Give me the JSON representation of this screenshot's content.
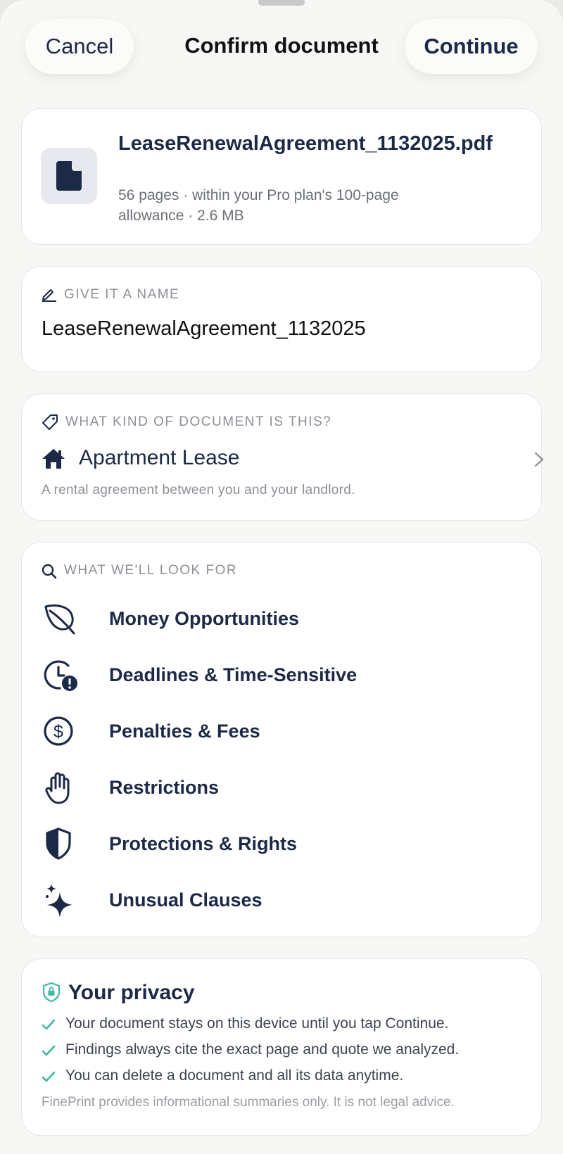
{
  "nav": {
    "cancel_label": "Cancel",
    "title": "Confirm document",
    "continue_label": "Continue"
  },
  "file": {
    "name": "LeaseRenewalAgreement_1132025.pdf",
    "meta": "56 pages · within your Pro plan's 100-page allowance · 2.6 MB",
    "icon": "document-icon"
  },
  "name_section": {
    "label": "GIVE IT A NAME",
    "icon": "pencil-icon",
    "value": "LeaseRenewalAgreement_1132025"
  },
  "doc_type": {
    "label": "WHAT KIND OF DOCUMENT IS THIS?",
    "icon": "tag-icon",
    "selected": "Apartment Lease",
    "selected_icon": "house-icon",
    "description": "A rental agreement between you and your landlord."
  },
  "look_for": {
    "label": "WHAT WE'LL LOOK FOR",
    "icon": "search-icon",
    "items": [
      {
        "label": "Money Opportunities",
        "icon": "leaf-icon"
      },
      {
        "label": "Deadlines & Time-Sensitive",
        "icon": "clock-alert-icon"
      },
      {
        "label": "Penalties & Fees",
        "icon": "dollar-circle-icon"
      },
      {
        "label": "Restrictions",
        "icon": "hand-icon"
      },
      {
        "label": "Protections & Rights",
        "icon": "shield-icon"
      },
      {
        "label": "Unusual Clauses",
        "icon": "sparkles-icon"
      }
    ]
  },
  "privacy": {
    "title": "Your privacy",
    "icon": "lock-shield-icon",
    "points": [
      "Your document stays on this device until you tap Continue.",
      "Findings always cite the exact page and quote we analyzed.",
      "You can delete a document and all its data anytime."
    ],
    "disclaimer": "FinePrint provides informational summaries only. It is not legal advice."
  },
  "colors": {
    "navy": "#1c2947",
    "teal_check": "#3fb8a1",
    "muted": "#8c8f96",
    "background": "#f7f7f5"
  }
}
